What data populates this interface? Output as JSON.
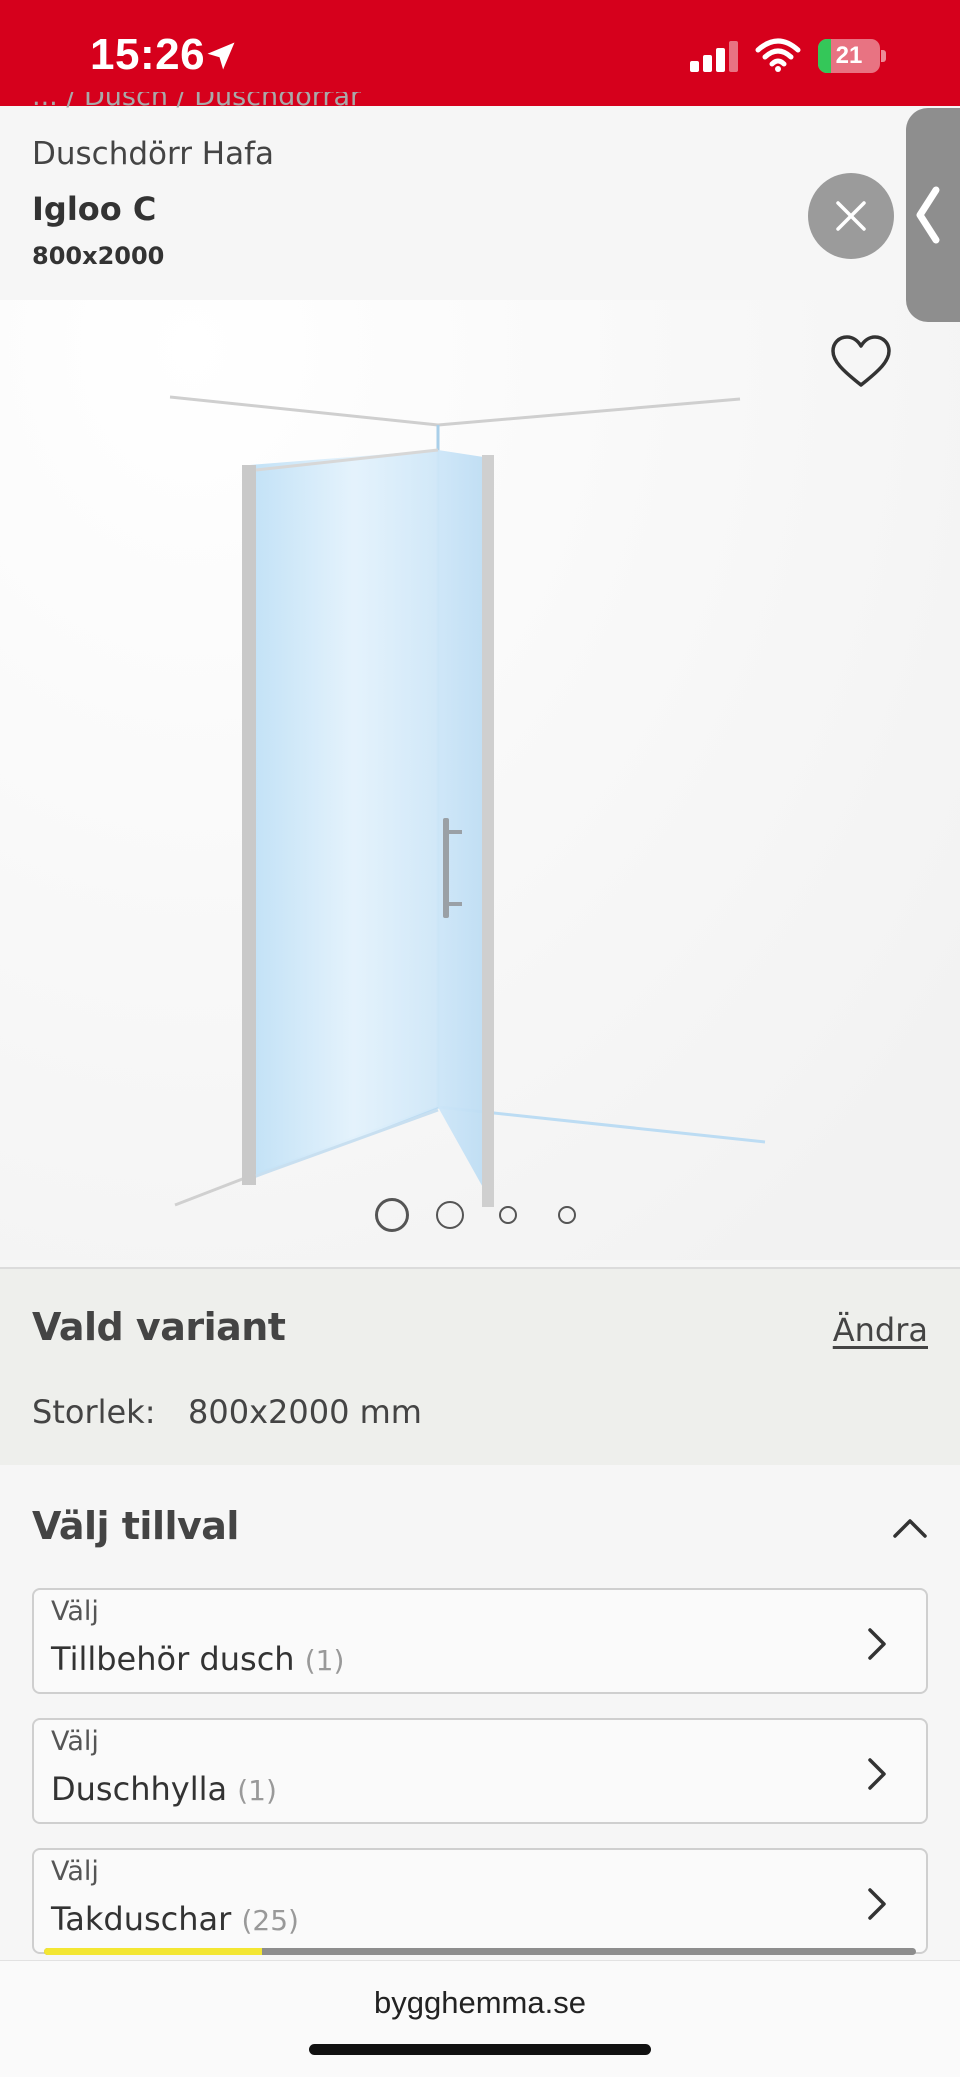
{
  "status_bar": {
    "time": "15:26",
    "battery_level": "21",
    "battery_fraction": 0.21,
    "colors": {
      "background": "#d6001c",
      "battery_fill": "#34c759"
    },
    "icons": [
      "location-arrow-icon",
      "cellular-signal-icon",
      "wifi-icon",
      "battery-icon"
    ]
  },
  "product": {
    "breadcrumb": "... / Dusch / Duschdörrar",
    "brand_line": "Duschdörr Hafa",
    "name": "Igloo C",
    "size": "800x2000"
  },
  "gallery": {
    "image": "shower-door-illustration",
    "slide_count": 4,
    "active_slide": 1
  },
  "variant": {
    "title": "Vald variant",
    "change_label": "Ändra",
    "size_label": "Storlek:",
    "size_value": "800x2000 mm"
  },
  "options": {
    "title": "Välj tillval",
    "items": [
      {
        "label": "Välj",
        "name": "Tillbehör dusch",
        "count": "(1)"
      },
      {
        "label": "Välj",
        "name": "Duschhylla",
        "count": "(1)"
      },
      {
        "label": "Välj",
        "name": "Takduschar",
        "count": "(25)"
      }
    ]
  },
  "page_load_progress": 0.25,
  "browser": {
    "url": "bygghemma.se"
  }
}
